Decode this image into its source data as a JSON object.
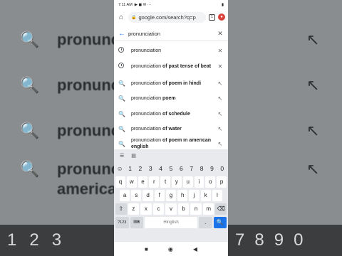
{
  "status": {
    "time": "7:11 AM",
    "icons": "▶ ◼ ✉ ···",
    "battery": "▮"
  },
  "browser": {
    "url": "google.com/search?q=p",
    "tab_count": "1"
  },
  "search": {
    "query": "pronunciation"
  },
  "suggestions": [
    {
      "prefix": "pronunciation",
      "bold": "",
      "type": "history",
      "action": "✕"
    },
    {
      "prefix": "pronunciation ",
      "bold": "of past tense of beat",
      "type": "history",
      "action": "✕"
    },
    {
      "prefix": "pronunciation ",
      "bold": "of poem in hindi",
      "type": "search",
      "action": "↖"
    },
    {
      "prefix": "pronunciation ",
      "bold": "poem",
      "type": "search",
      "action": "↖"
    },
    {
      "prefix": "pronunciation ",
      "bold": "of schedule",
      "type": "search",
      "action": "↖"
    },
    {
      "prefix": "pronunciation ",
      "bold": "of water",
      "type": "search",
      "action": "↖"
    },
    {
      "prefix": "pronunciation ",
      "bold": "of poem in american english",
      "type": "search",
      "action": "↖"
    }
  ],
  "keyboard": {
    "numbers": [
      "1",
      "2",
      "3",
      "4",
      "5",
      "6",
      "7",
      "8",
      "9",
      "0"
    ],
    "row1": [
      "q",
      "w",
      "e",
      "r",
      "t",
      "y",
      "u",
      "i",
      "o",
      "p"
    ],
    "row2": [
      "a",
      "s",
      "d",
      "f",
      "g",
      "h",
      "j",
      "k",
      "l"
    ],
    "row3": [
      "z",
      "x",
      "c",
      "v",
      "b",
      "n",
      "m"
    ],
    "symbols_label": "?123",
    "space_label": "Hinglish",
    "period": "."
  },
  "background": {
    "rows": [
      "pronunciation",
      "pronunciation",
      "pronunciation",
      "pronunciation",
      "american"
    ],
    "numbers": [
      "1",
      "2",
      "3",
      "7",
      "8",
      "9",
      "0"
    ]
  }
}
